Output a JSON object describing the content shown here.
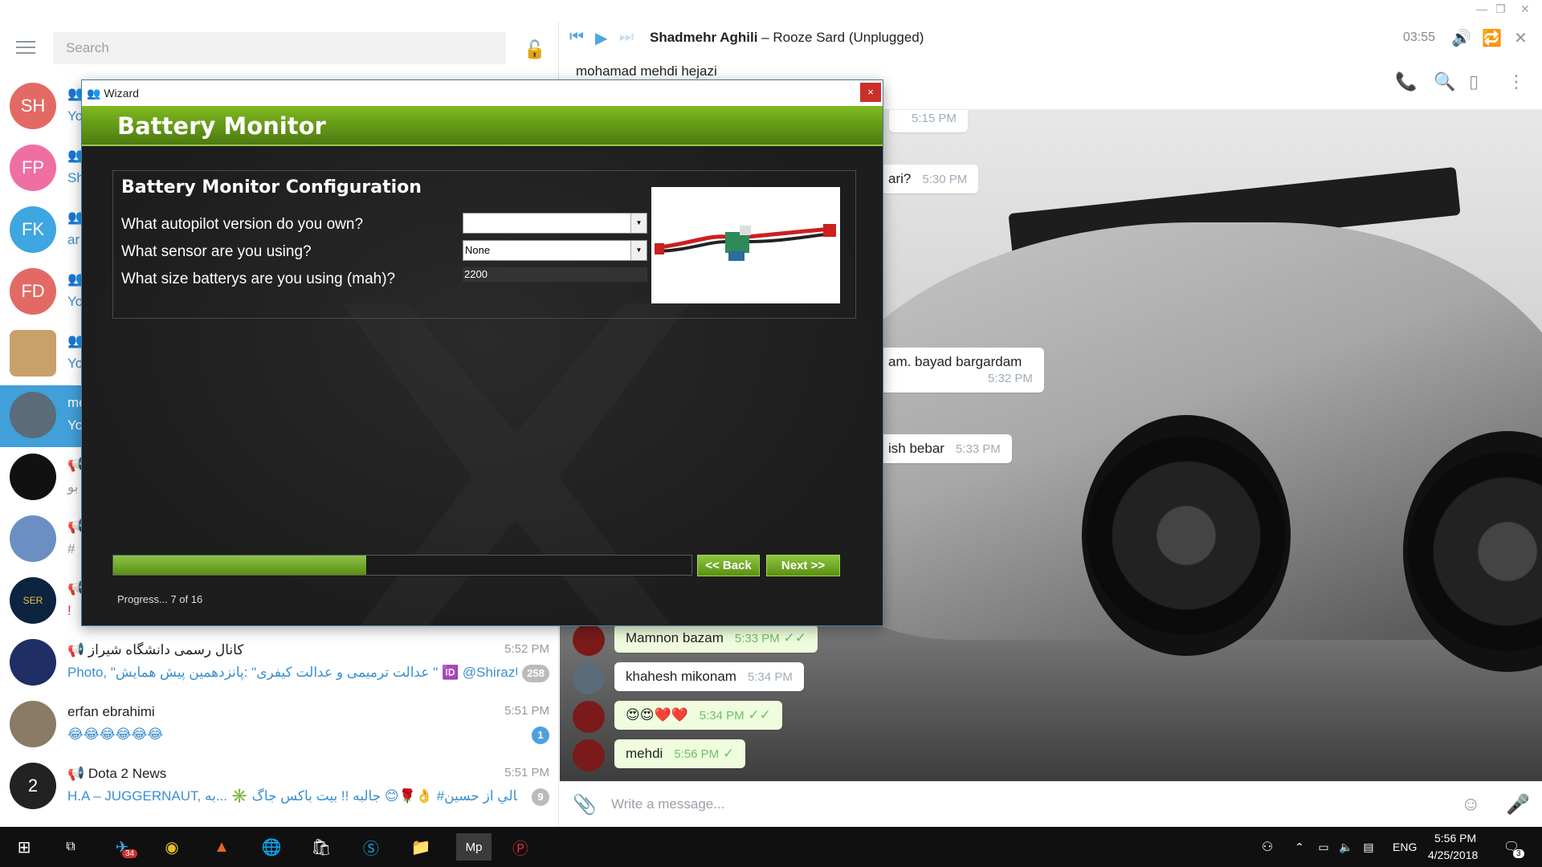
{
  "window": {
    "minimize": "—",
    "maximize": "❐",
    "close": "✕"
  },
  "left": {
    "search_placeholder": "Search",
    "chats": [
      {
        "initials": "SH",
        "title": "",
        "sub": "Yo",
        "color": "#e36a64"
      },
      {
        "initials": "FP",
        "title": "",
        "sub": "Sh",
        "color": "#ef6fa2"
      },
      {
        "initials": "FK",
        "title": "",
        "sub": "ar",
        "color": "#3ea6e0"
      },
      {
        "initials": "FD",
        "title": "",
        "sub": "Yo",
        "color": "#e36a64"
      },
      {
        "initials": "",
        "title": "",
        "sub": "Yo",
        "color": "#c8a06a"
      },
      {
        "initials": "",
        "title": "me",
        "sub": "Yo",
        "color": "#5a6b7a"
      },
      {
        "initials": "",
        "title": "",
        "sub": "بو",
        "color": "#111111"
      },
      {
        "initials": "",
        "title": "",
        "sub": "#",
        "color": "#6c8fc3"
      },
      {
        "initials": "",
        "title": "",
        "sub": "!",
        "color": "#0c2440"
      },
      {
        "initials": "",
        "title": "کانال رسمی دانشگاه شیراز",
        "sub": "Photo, \"عدالت ترمیمی و عدالت کیفری\" :پانزدهمین پیش همایش \" 🆔 @ShirazU...",
        "time": "5:52 PM",
        "badge": "258",
        "color": "#1f2f66"
      },
      {
        "initials": "",
        "title": "erfan ebrahimi",
        "sub": "😂😂😂😂😂😂",
        "time": "5:51 PM",
        "badge": "1",
        "color": "#8a7a66"
      },
      {
        "initials": "",
        "title": "Dota 2 News",
        "sub": "H.A – JUGGERNAUT, ارسالي از حسين# 👌🌹😊 جالبه !! بیت باکس جاگ ✳️ ...به",
        "time": "5:51 PM",
        "badge": "9",
        "color": "#222222"
      }
    ]
  },
  "player": {
    "artist": "Shadmehr Aghili",
    "title": " – Rooze Sard (Unplugged)",
    "time": "03:55"
  },
  "peer": {
    "name": "mohamad mehdi hejazi"
  },
  "messages": [
    {
      "text": "",
      "time": "5:15 PM"
    },
    {
      "text": "ari?",
      "time": "5:30 PM"
    },
    {
      "text": "am. bayad bargardam",
      "time": "5:32 PM"
    },
    {
      "text": "ish bebar",
      "time": "5:33 PM"
    },
    {
      "text": "Mamnon bazam",
      "time": "5:33 PM",
      "out": true
    },
    {
      "text": "khahesh mikonam",
      "time": "5:34 PM"
    },
    {
      "text": "😍😍❤️❤️",
      "time": "5:34 PM",
      "out": true
    },
    {
      "text": "mehdi",
      "time": "5:56 PM",
      "out": true
    }
  ],
  "compose": {
    "placeholder": "Write a message..."
  },
  "wizard": {
    "window_title": "Wizard",
    "close": "×",
    "banner": "Battery Monitor",
    "heading": "Battery Monitor Configuration",
    "q1": "What autopilot version do you own?",
    "q2": "What sensor are you using?",
    "q3": "What size batterys are you using (mah)?",
    "autopilot_value": "",
    "sensor_value": "None",
    "battery_value": "2200",
    "progress": {
      "current": 7,
      "total": 16,
      "label": "Progress... 7 of 16"
    },
    "back": "<< Back",
    "next": "Next >>"
  },
  "taskbar": {
    "telegram_badge": "34",
    "lang": "ENG",
    "time": "5:56 PM",
    "date": "4/25/2018",
    "notif": "3"
  }
}
